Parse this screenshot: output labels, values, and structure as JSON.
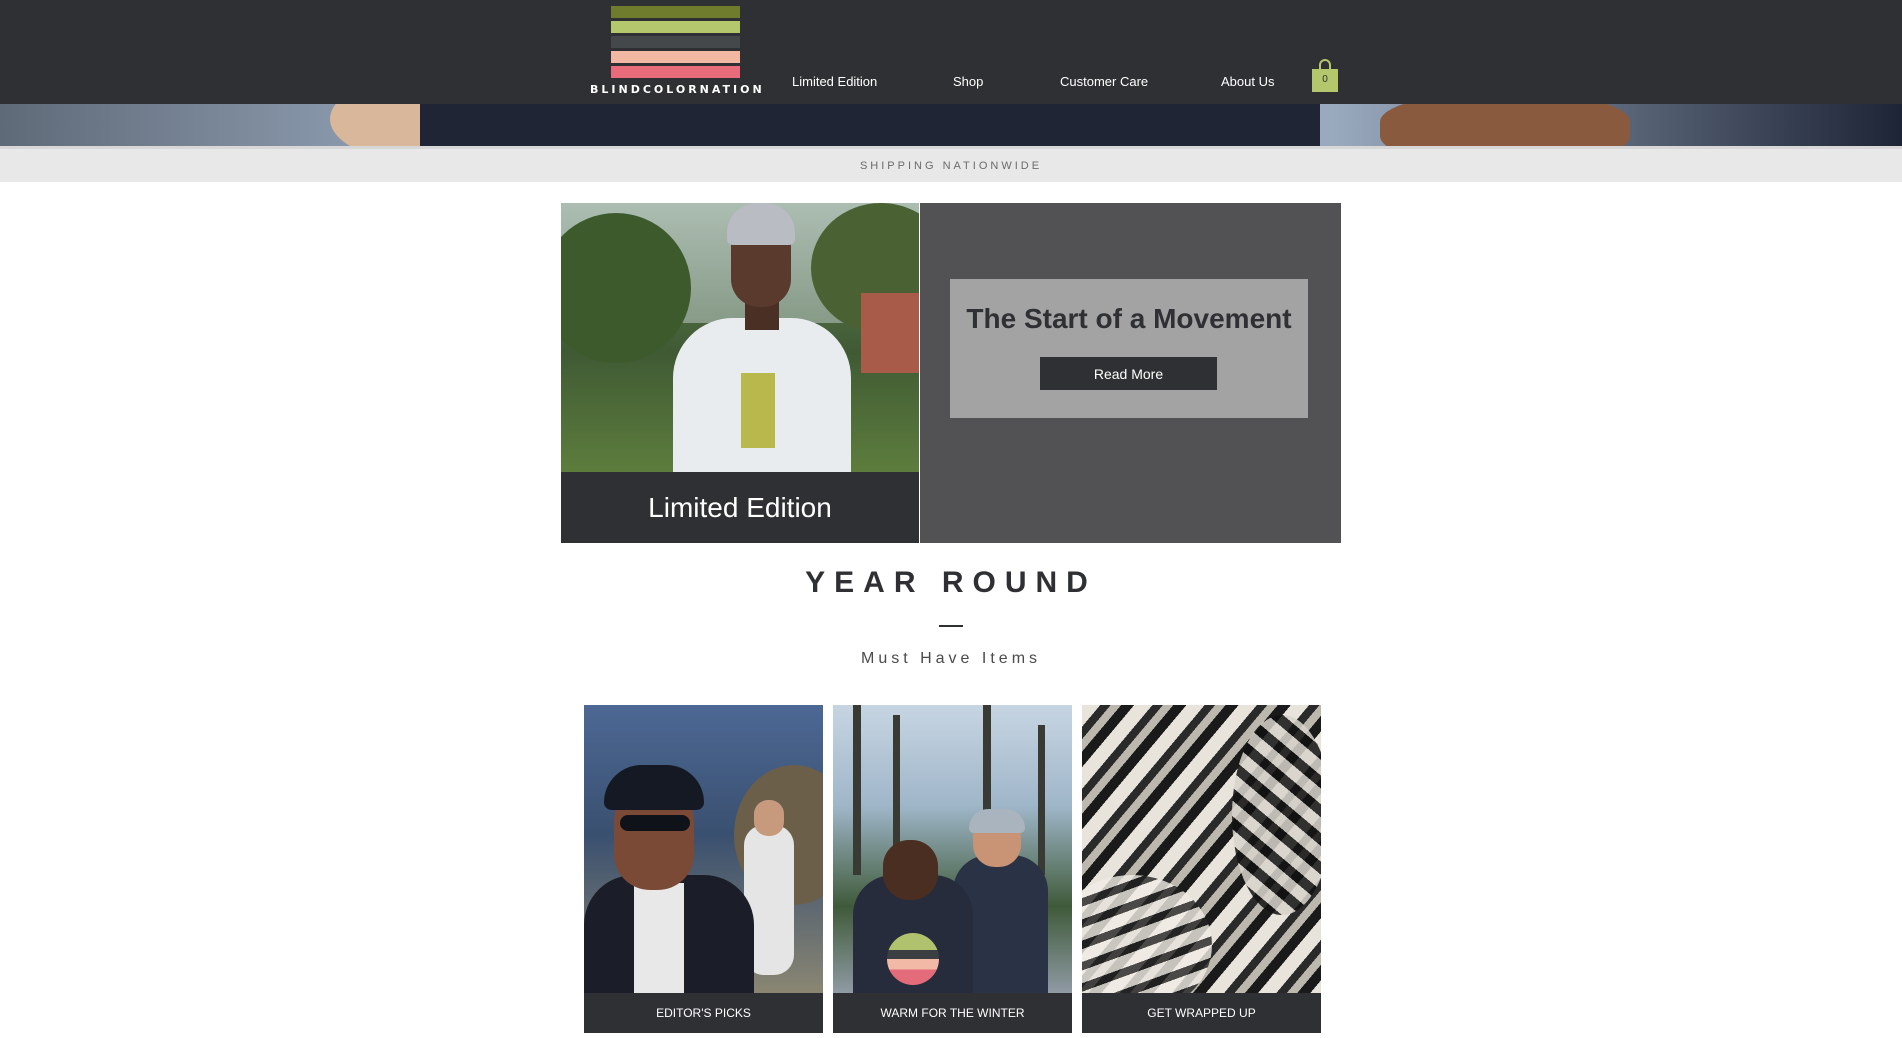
{
  "header": {
    "brand": "BLINDCOLORNATION",
    "logo_colors": [
      "#6f7b2d",
      "#b5c76c",
      "#44484b",
      "#f3b8a3",
      "#e96c7d"
    ],
    "nav": [
      {
        "label": "Limited Edition"
      },
      {
        "label": "Shop"
      },
      {
        "label": "Customer Care"
      },
      {
        "label": "About Us"
      }
    ],
    "cart": {
      "count": "0",
      "icon": "shopping-bag-icon",
      "color": "#b5c76c"
    }
  },
  "banner": {
    "text": "SHIPPING NATIONWIDE"
  },
  "feature": {
    "caption": "Limited Edition",
    "headline": "The Start of a Movement",
    "button_label": "Read More"
  },
  "year_round": {
    "title": "YEAR ROUND",
    "subtitle": "Must Have Items",
    "cards": [
      {
        "label": "EDITOR'S PICKS"
      },
      {
        "label": "WARM FOR THE WINTER"
      },
      {
        "label": "GET WRAPPED UP"
      }
    ]
  }
}
